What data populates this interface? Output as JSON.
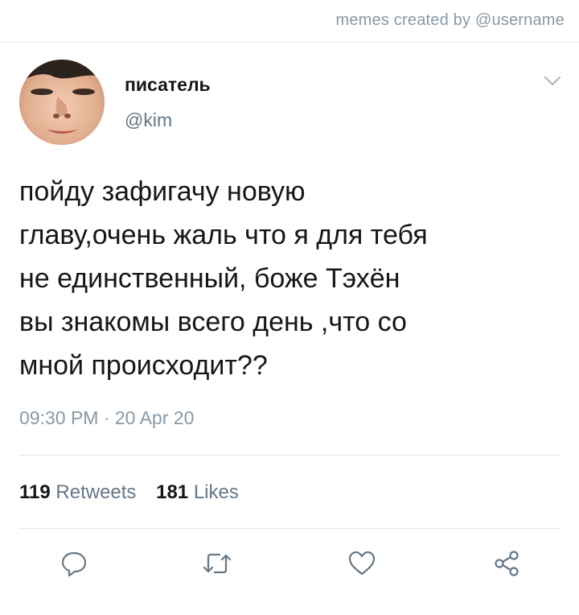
{
  "watermark": "memes created by @username",
  "tweet": {
    "author_name": "писатель",
    "author_handle": "@kim",
    "text": "пойду зафигачу новую\nглаву,очень жаль что я для тебя\nне единственный, боже Тэхён\nвы знакомы всего день ,что со\nмной происходит??",
    "timestamp": "09:30 PM · 20 Apr 20"
  },
  "stats": {
    "retweets_count": "119",
    "retweets_label": "Retweets",
    "likes_count": "181",
    "likes_label": "Likes"
  },
  "icons": {
    "avatar": "avatar-photo",
    "menu": "chevron-down-icon",
    "reply": "reply-icon",
    "retweet": "retweet-icon",
    "like": "heart-icon",
    "share": "share-icon"
  },
  "colors": {
    "text": "#14171a",
    "secondary": "#657786",
    "muted": "#8899a6",
    "divider": "#e1e8ed",
    "icon": "#657786"
  }
}
